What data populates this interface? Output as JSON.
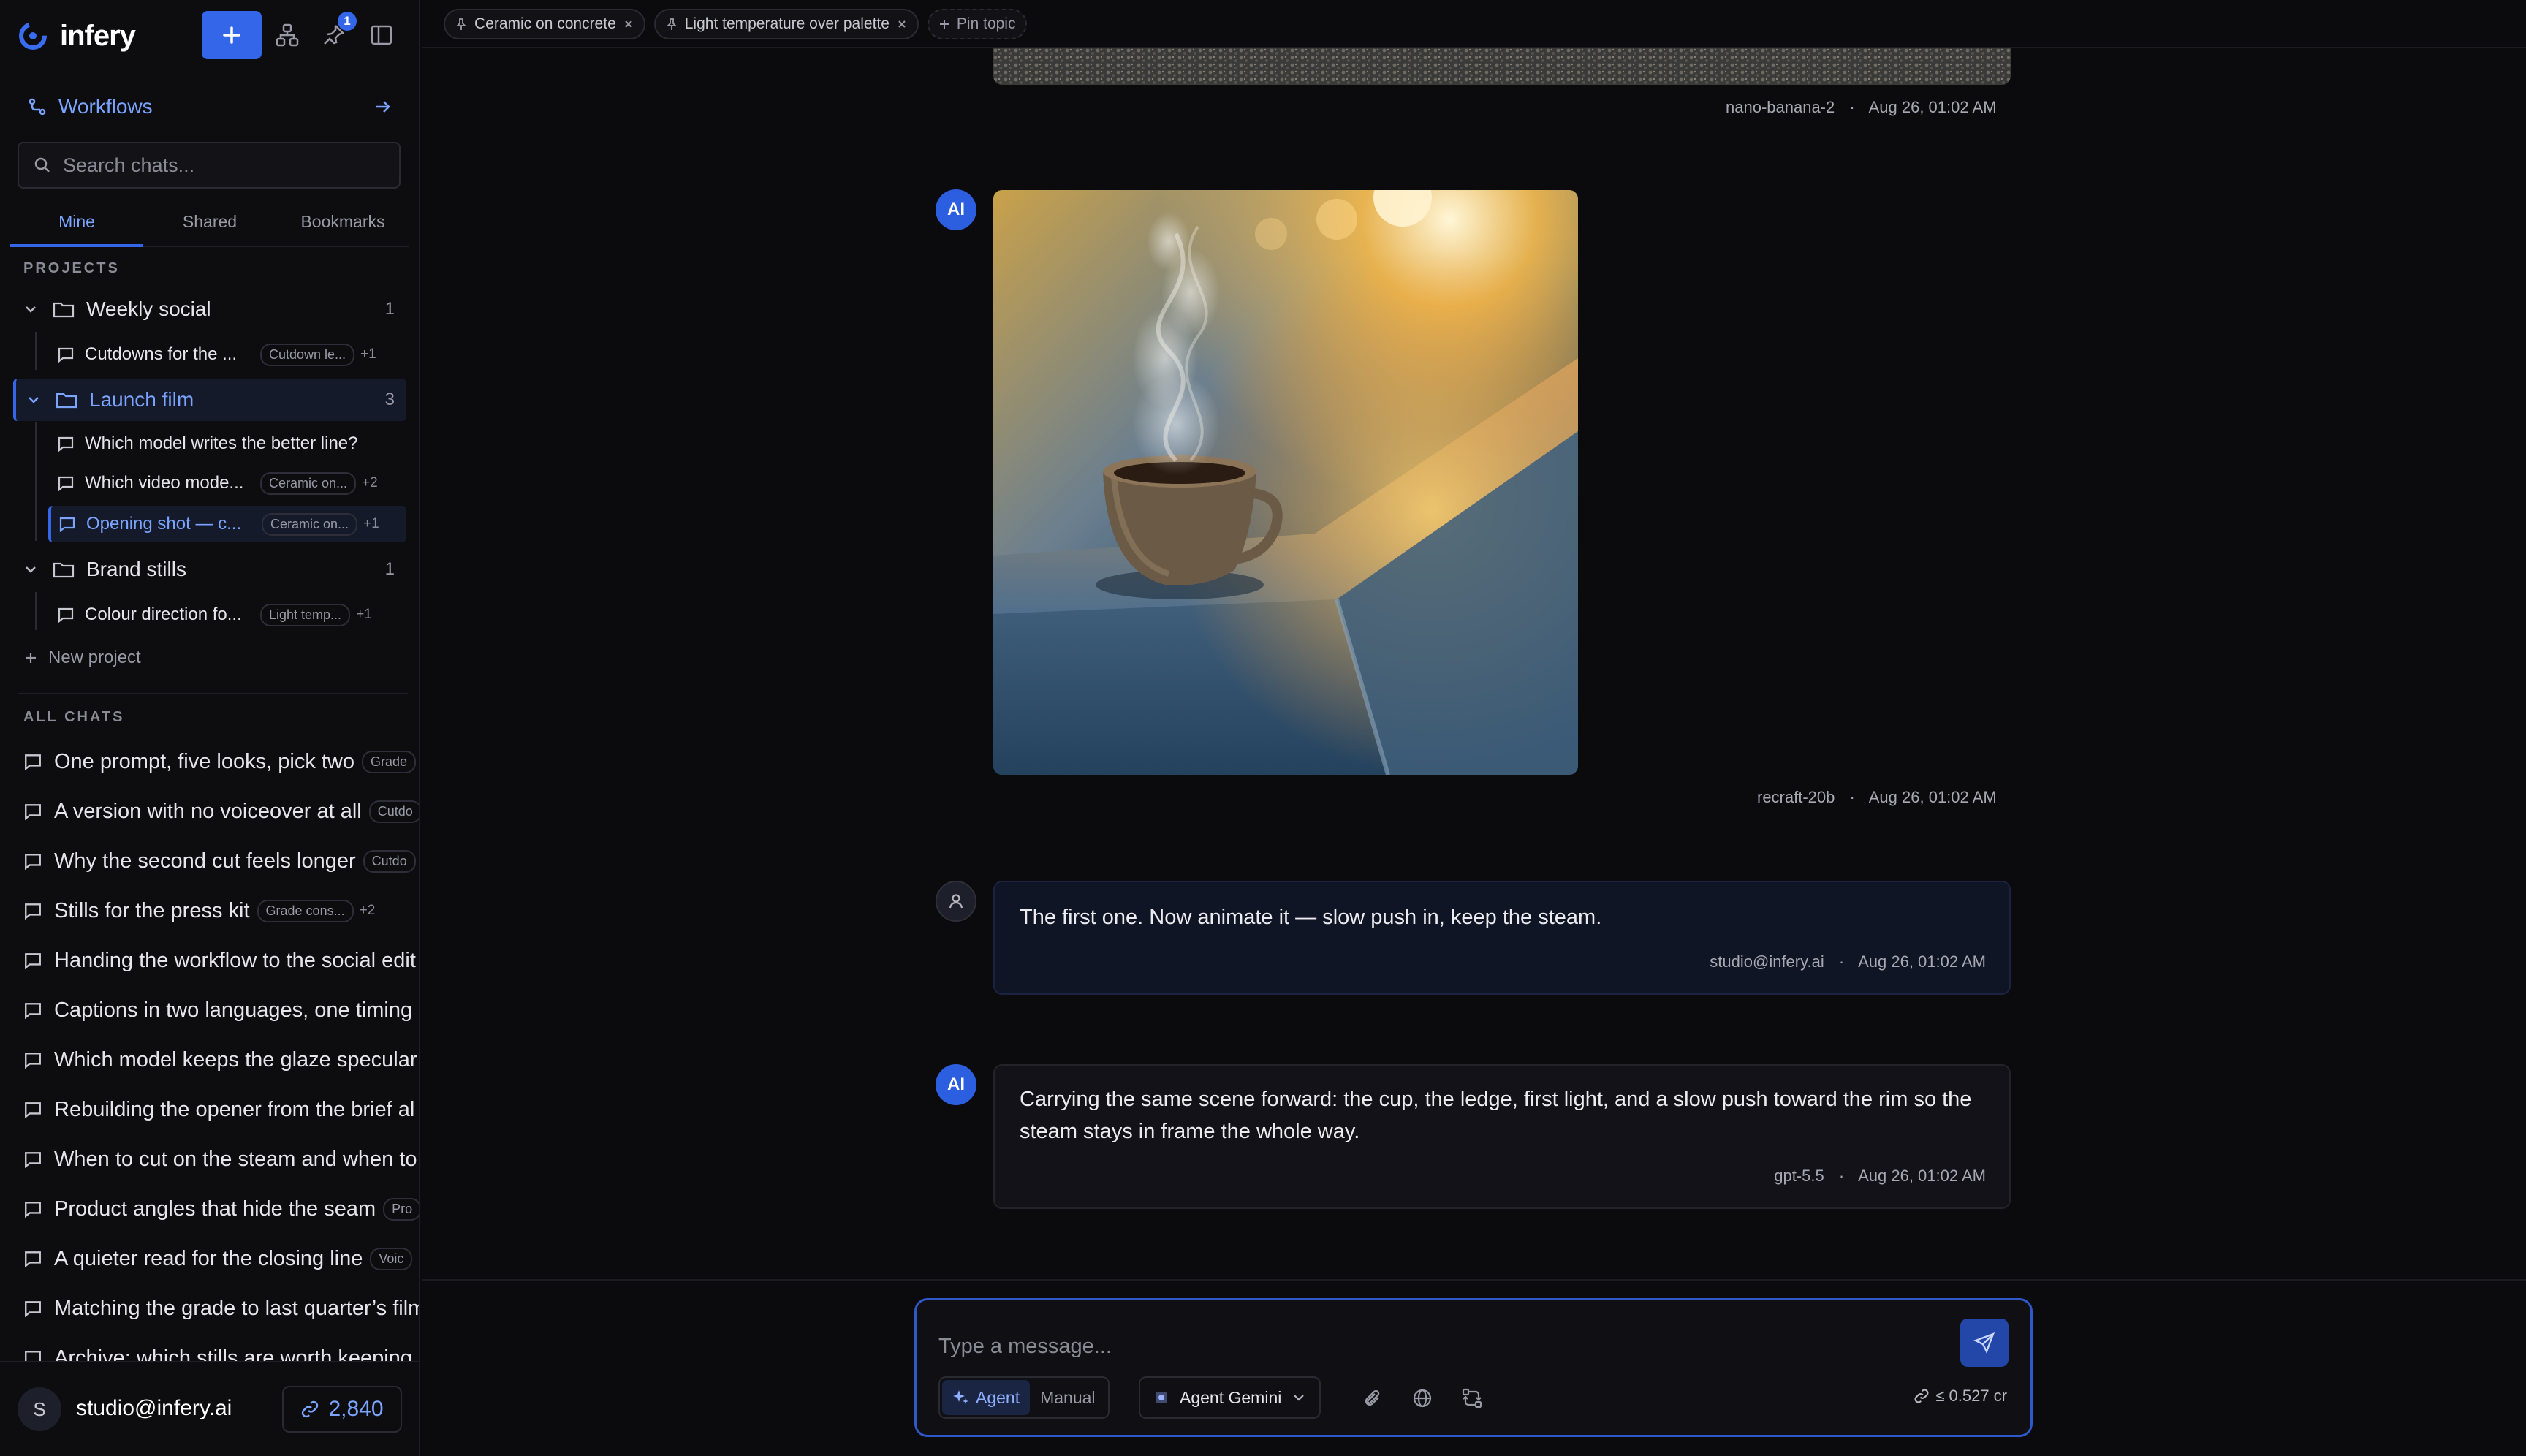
{
  "app": {
    "name": "infery",
    "notification_count": "1"
  },
  "sidebar": {
    "workflows_label": "Workflows",
    "search_placeholder": "Search chats...",
    "tabs": [
      "Mine",
      "Shared",
      "Bookmarks"
    ],
    "projects_heading": "PROJECTS",
    "projects": [
      {
        "name": "Weekly social",
        "count": "1",
        "chats": [
          {
            "title": "Cutdowns for the ...",
            "tag": "Cutdown le...",
            "extra": "+1"
          }
        ]
      },
      {
        "name": "Launch film",
        "count": "3",
        "chats": [
          {
            "title": "Which model writes the better line?",
            "tag": "",
            "extra": ""
          },
          {
            "title": "Which video mode...",
            "tag": "Ceramic on...",
            "extra": "+2"
          },
          {
            "title": "Opening shot — c...",
            "tag": "Ceramic on...",
            "extra": "+1"
          }
        ]
      },
      {
        "name": "Brand stills",
        "count": "1",
        "chats": [
          {
            "title": "Colour direction fo...",
            "tag": "Light temp...",
            "extra": "+1"
          }
        ]
      }
    ],
    "new_project_label": "New project",
    "all_chats_heading": "ALL CHATS",
    "all_chats": [
      {
        "title": "One prompt, five looks, pick two",
        "tag": "Grade",
        "extra": ""
      },
      {
        "title": "A version with no voiceover at all",
        "tag": "Cutdo",
        "extra": ""
      },
      {
        "title": "Why the second cut feels longer",
        "tag": "Cutdo",
        "extra": ""
      },
      {
        "title": "Stills for the press kit",
        "tag": "Grade cons...",
        "extra": "+2"
      },
      {
        "title": "Handing the workflow to the social edit",
        "tag": "",
        "extra": ""
      },
      {
        "title": "Captions in two languages, one timing",
        "tag": "",
        "extra": ""
      },
      {
        "title": "Which model keeps the glaze specular",
        "tag": "",
        "extra": ""
      },
      {
        "title": "Rebuilding the opener from the brief al",
        "tag": "",
        "extra": ""
      },
      {
        "title": "When to cut on the steam and when to",
        "tag": "",
        "extra": ""
      },
      {
        "title": "Product angles that hide the seam",
        "tag": "Pro",
        "extra": ""
      },
      {
        "title": "A quieter read for the closing line",
        "tag": "Voic",
        "extra": ""
      },
      {
        "title": "Matching the grade to last quarter’s film",
        "tag": "",
        "extra": ""
      },
      {
        "title": "Archive: which stills are worth keeping",
        "tag": "",
        "extra": ""
      }
    ],
    "user": {
      "initial": "S",
      "email": "studio@infery.ai",
      "credits": "2,840"
    }
  },
  "pinned_topics": [
    "Ceramic on concrete",
    "Light temperature over palette"
  ],
  "pin_topic_label": "Pin topic",
  "messages": [
    {
      "meta_model": "nano-banana-2",
      "meta_time": "Aug 26, 01:02 AM"
    },
    {
      "avatar": "AI",
      "meta_model": "recraft-20b",
      "meta_time": "Aug 26, 01:02 AM"
    },
    {
      "text": "The first one. Now animate it — slow push in, keep the steam.",
      "meta_model": "studio@infery.ai",
      "meta_time": "Aug 26, 01:02 AM"
    },
    {
      "avatar": "AI",
      "text": "Carrying the same scene forward: the cup, the ledge, first light, and a slow push toward the rim so the steam stays in frame the whole way.",
      "meta_model": "gpt-5.5",
      "meta_time": "Aug 26, 01:02 AM"
    }
  ],
  "meta_separator": "·",
  "composer": {
    "placeholder": "Type a message...",
    "mode_agent": "Agent",
    "mode_manual": "Manual",
    "model": "Agent Gemini",
    "cost": "≤ 0.527 cr"
  },
  "colors": {
    "accent": "#3366e8",
    "accent_text": "#7aa4ff",
    "background": "#0b0b0e"
  },
  "icons": [
    "logo-icon",
    "plus-icon",
    "workflow-icon",
    "pin-icon",
    "sidebar-toggle-icon",
    "arrow-right-icon",
    "search-icon",
    "chevron-down-icon",
    "folder-icon",
    "chat-icon",
    "link-icon",
    "close-icon",
    "user-icon",
    "send-icon",
    "sparkle-icon",
    "attach-icon",
    "globe-icon",
    "swap-icon"
  ]
}
